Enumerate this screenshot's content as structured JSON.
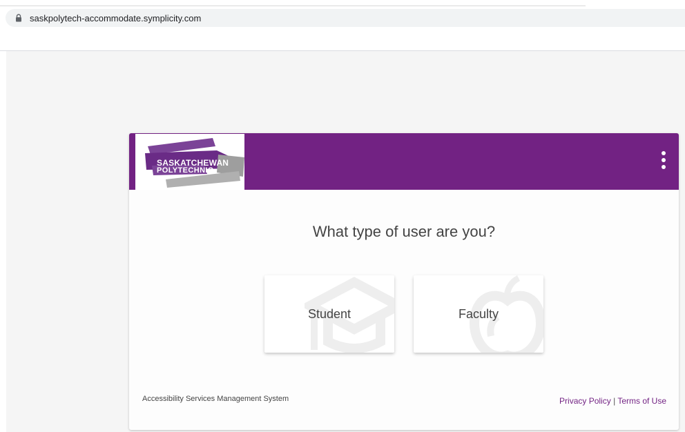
{
  "browser": {
    "url": "saskpolytech-accommodate.symplicity.com",
    "lock_icon": "lock-icon"
  },
  "header": {
    "logo_line1": "SASKATCHEWAN",
    "logo_line2": "POLYTECHNIC",
    "brand_color": "#722283",
    "menu_icon": "kebab-menu-icon"
  },
  "main": {
    "question": "What type of user are you?",
    "roles": [
      {
        "label": "Student",
        "icon": "graduation-cap-icon"
      },
      {
        "label": "Faculty",
        "icon": "apple-icon"
      }
    ]
  },
  "footer": {
    "system_name": "Accessibility Services Management System",
    "privacy_link": "Privacy Policy",
    "separator": "|",
    "terms_link": "Terms of Use"
  }
}
